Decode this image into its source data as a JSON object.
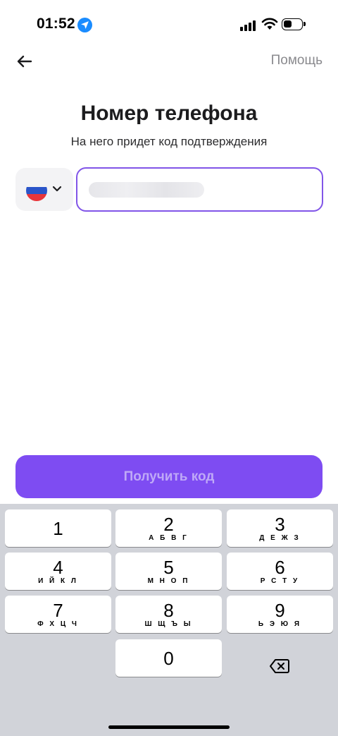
{
  "status_bar": {
    "time": "01:52"
  },
  "header": {
    "help_label": "Помощь"
  },
  "title": "Номер телефона",
  "subtitle": "На него придет код подтверждения",
  "phone": {
    "value": "",
    "placeholder": ""
  },
  "cta_label": "Получить код",
  "keyboard": {
    "keys": [
      {
        "digit": "1",
        "letters": ""
      },
      {
        "digit": "2",
        "letters": "А Б В Г"
      },
      {
        "digit": "3",
        "letters": "Д Е Ж З"
      },
      {
        "digit": "4",
        "letters": "И Й К Л"
      },
      {
        "digit": "5",
        "letters": "М Н О П"
      },
      {
        "digit": "6",
        "letters": "Р С Т У"
      },
      {
        "digit": "7",
        "letters": "Ф Х Ц Ч"
      },
      {
        "digit": "8",
        "letters": "Ш Щ Ъ Ы"
      },
      {
        "digit": "9",
        "letters": "Ь Э Ю Я"
      },
      {
        "digit": "0",
        "letters": ""
      }
    ]
  },
  "icons": {
    "back": "arrow-left-icon",
    "location": "location-arrow-icon",
    "flag": "russia-flag-icon",
    "chevron": "chevron-down-icon",
    "delete": "backspace-icon"
  },
  "colors": {
    "accent": "#7e4cf2",
    "input_border": "#8155e8",
    "keyboard_bg": "#d1d3d9"
  }
}
